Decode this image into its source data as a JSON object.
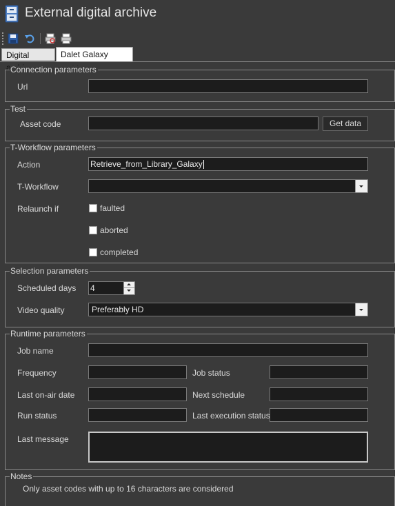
{
  "window": {
    "title": "External digital archive"
  },
  "toolbar": {
    "items": [
      {
        "icon": "save-icon"
      },
      {
        "icon": "undo-icon"
      },
      {
        "icon": "print-preview-icon"
      },
      {
        "icon": "print-icon"
      }
    ]
  },
  "tabs": [
    {
      "label": "Digital archive",
      "active": false
    },
    {
      "label": "Dalet Galaxy archive",
      "active": true
    }
  ],
  "connection": {
    "legend": "Connection parameters",
    "url_label": "Url",
    "url_value": ""
  },
  "test": {
    "legend": "Test",
    "asset_code_label": "Asset code",
    "asset_code_value": "",
    "get_data_label": "Get data"
  },
  "tworkflow": {
    "legend": "T-Workflow parameters",
    "action_label": "Action",
    "action_value": "Retrieve_from_Library_Galaxy",
    "tworkflow_label": "T-Workflow",
    "tworkflow_value": "",
    "relaunch_label": "Relaunch if",
    "options": [
      {
        "label": "faulted",
        "checked": false
      },
      {
        "label": "aborted",
        "checked": false
      },
      {
        "label": "completed",
        "checked": false
      }
    ]
  },
  "selection": {
    "legend": "Selection parameters",
    "scheduled_days_label": "Scheduled days",
    "scheduled_days_value": "4",
    "video_quality_label": "Video quality",
    "video_quality_value": "Preferably HD"
  },
  "runtime": {
    "legend": "Runtime parameters",
    "job_name_label": "Job name",
    "frequency_label": "Frequency",
    "job_status_label": "Job status",
    "last_onair_label": "Last on-air date",
    "next_schedule_label": "Next schedule",
    "run_status_label": "Run status",
    "last_exec_label": "Last execution status",
    "last_message_label": "Last message"
  },
  "notes": {
    "legend": "Notes",
    "text": "Only asset codes with up to 16 characters are considered"
  }
}
